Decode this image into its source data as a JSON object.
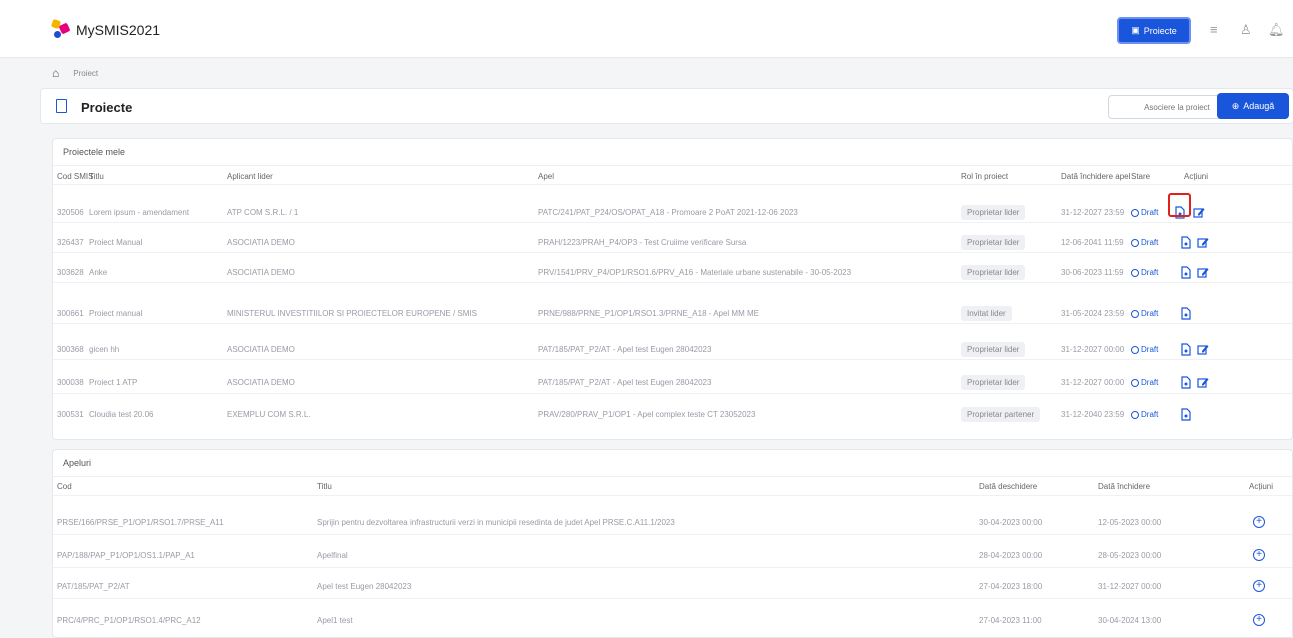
{
  "app": {
    "title": "MySMIS2021"
  },
  "topbar": {
    "proiecte_label": "Proiecte"
  },
  "breadcrumb": {
    "current": "Proiect"
  },
  "page": {
    "title": "Proiecte",
    "associate_label": "Asociere la proiect",
    "add_label": "Adaugă"
  },
  "projects": {
    "title": "Proiectele mele",
    "columns": [
      "Cod SMIS",
      "Titlu",
      "Aplicant lider",
      "Apel",
      "Rol în proiect",
      "Dată închidere apel",
      "Stare",
      "Acțiuni"
    ],
    "rows": [
      {
        "cod": "320506",
        "titlu": "Lorem ipsum - amendament",
        "aplicant": "ATP COM S.R.L. / 1",
        "apel": "PATC/241/PAT_P24/OS/OPAT_A18 - Promoare 2 PoAT 2021-12-06 2023",
        "rol": "Proprietar lider",
        "data": "31-12-2027 23:59",
        "stare": "Draft",
        "edit": true
      },
      {
        "cod": "326437",
        "titlu": "Proiect Manual",
        "aplicant": "ASOCIATIA DEMO",
        "apel": "PRAH/1223/PRAH_P4/OP3 - Test Cruiime verificare Sursa",
        "rol": "Proprietar lider",
        "data": "12-06-2041 11:59",
        "stare": "Draft",
        "edit": true
      },
      {
        "cod": "303628",
        "titlu": "Anke",
        "aplicant": "ASOCIATIA DEMO",
        "apel": "PRV/1541/PRV_P4/OP1/RSO1.6/PRV_A16 - Materiale urbane sustenabile - 30-05-2023",
        "rol": "Proprietar lider",
        "data": "30-06-2023 11:59",
        "stare": "Draft",
        "edit": true
      },
      {
        "cod": "300661",
        "titlu": "Proiect manual",
        "aplicant": "MINISTERUL INVESTITIILOR SI PROIECTELOR EUROPENE / SMIS",
        "apel": "PRNE/988/PRNE_P1/OP1/RSO1.3/PRNE_A18 - Apel MM ME",
        "rol": "Invitat lider",
        "data": "31-05-2024 23:59",
        "stare": "Draft",
        "edit": false
      },
      {
        "cod": "300368",
        "titlu": "gicen hh",
        "aplicant": "ASOCIATIA DEMO",
        "apel": "PAT/185/PAT_P2/AT - Apel test Eugen 28042023",
        "rol": "Proprietar lider",
        "data": "31-12-2027 00:00",
        "stare": "Draft",
        "edit": true
      },
      {
        "cod": "300038",
        "titlu": "Proiect 1 ATP",
        "aplicant": "ASOCIATIA DEMO",
        "apel": "PAT/185/PAT_P2/AT - Apel test Eugen 28042023",
        "rol": "Proprietar lider",
        "data": "31-12-2027 00:00",
        "stare": "Draft",
        "edit": true
      },
      {
        "cod": "300531",
        "titlu": "Cloudia test 20.06",
        "aplicant": "EXEMPLU COM S.R.L.",
        "apel": "PRAV/280/PRAV_P1/OP1 - Apel complex teste CT 23052023",
        "rol": "Proprietar partener",
        "data": "31-12-2040 23:59",
        "stare": "Draft",
        "edit": false
      }
    ]
  },
  "calls": {
    "title": "Apeluri",
    "columns": [
      "Cod",
      "Titlu",
      "Dată deschidere",
      "Dată închidere",
      "Acțiuni"
    ],
    "rows": [
      {
        "cod": "PRSE/166/PRSE_P1/OP1/RSO1.7/PRSE_A11",
        "titlu": "Sprijin pentru dezvoltarea infrastructurii verzi in municipii resedinta de judet Apel PRSE.C.A11.1/2023",
        "deschidere": "30-04-2023 00:00",
        "inchidere": "12-05-2023 00:00"
      },
      {
        "cod": "PAP/188/PAP_P1/OP1/OS1.1/PAP_A1",
        "titlu": "Apelfinal",
        "deschidere": "28-04-2023 00:00",
        "inchidere": "28-05-2023 00:00"
      },
      {
        "cod": "PAT/185/PAT_P2/AT",
        "titlu": "Apel test Eugen 28042023",
        "deschidere": "27-04-2023 18:00",
        "inchidere": "31-12-2027 00:00"
      },
      {
        "cod": "PRC/4/PRC_P1/OP1/RSO1.4/PRC_A12",
        "titlu": "Apel1 test",
        "deschidere": "27-04-2023 11:00",
        "inchidere": "30-04-2024 13:00"
      }
    ]
  }
}
